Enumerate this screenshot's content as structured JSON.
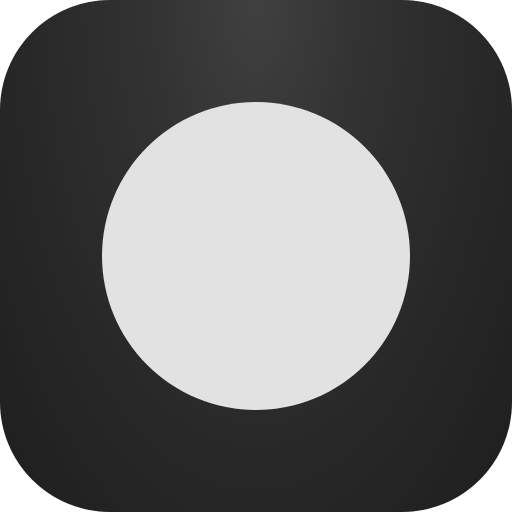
{
  "icon": {
    "name": "record-circle-app-icon",
    "background_color": "#2c2c2c",
    "circle_color": "#e2e2e2"
  }
}
